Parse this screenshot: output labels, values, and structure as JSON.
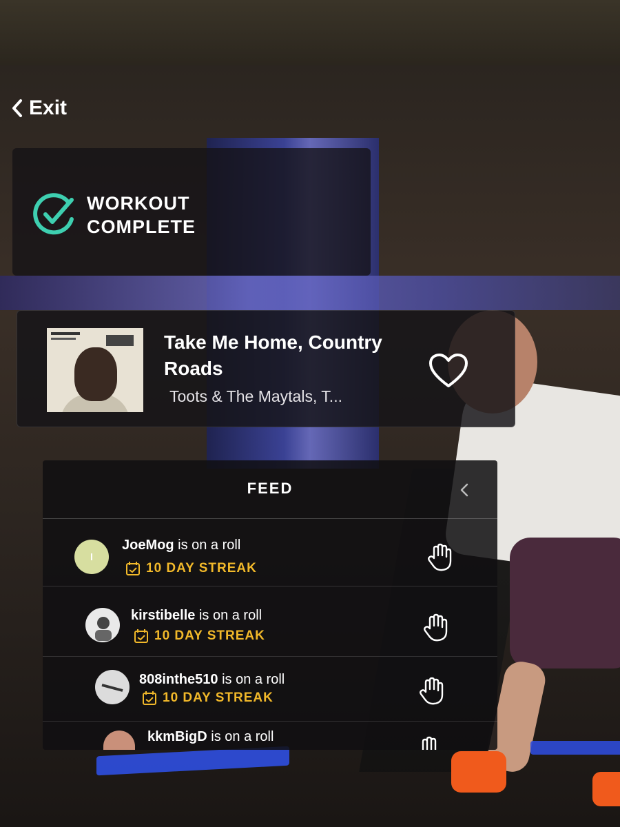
{
  "nav": {
    "exit_label": "Exit"
  },
  "status": {
    "line1": "WORKOUT",
    "line2": "COMPLETE"
  },
  "music": {
    "title": "Take Me Home, Country Roads",
    "artist": "Toots & The Maytals, T..."
  },
  "feed": {
    "title": "FEED",
    "items": [
      {
        "username": "JoeMog",
        "action": "is on a roll",
        "streak": "10 DAY STREAK"
      },
      {
        "username": "kirstibelle",
        "action": "is on a roll",
        "streak": "10 DAY STREAK"
      },
      {
        "username": "808inthe510",
        "action": "is on a roll",
        "streak": "10 DAY STREAK"
      },
      {
        "username": "kkmBigD",
        "action": "is on a roll",
        "streak": ""
      }
    ]
  },
  "colors": {
    "accent_check": "#3ecfb0",
    "streak": "#f2b92a"
  },
  "icons": [
    "chevron-left-icon",
    "check-circle-icon",
    "heart-icon",
    "chevron-left-icon",
    "calendar-check-icon",
    "high-five-icon"
  ]
}
